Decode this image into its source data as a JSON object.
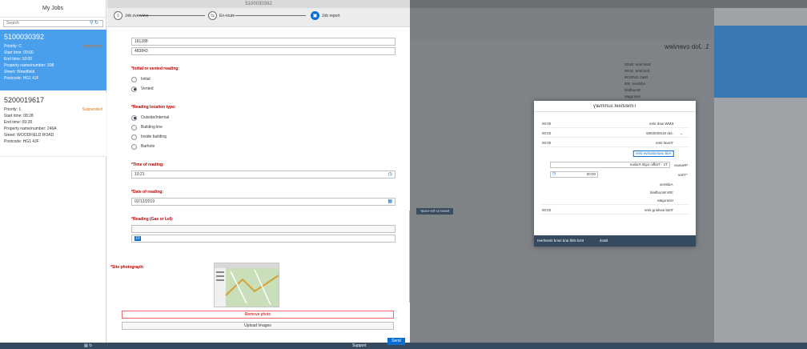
{
  "master": {
    "title": "My Jobs",
    "search_placeholder": "Search",
    "jobs": [
      {
        "id": "5100030392",
        "priority": "Priority: C",
        "status": "Suspended",
        "start": "Start time: 09:00",
        "end": "End time: 10:00",
        "property": "Property name/number: 308",
        "street": "Street: Woodfield",
        "postcode": "Postcode: HG1 4JF"
      },
      {
        "id": "5200019617",
        "priority": "Priority: 1",
        "status": "Suspended",
        "start": "Start time: 08:28",
        "end": "End time: 09:28",
        "property": "Property name/number: 246A",
        "street": "Street: WOODFIELD ROAD",
        "postcode": "Postcode: HG1 4JF"
      }
    ]
  },
  "detail": {
    "title": "5100030392",
    "steps": [
      {
        "label": "Job overview"
      },
      {
        "label": "En-route"
      },
      {
        "label": "Job report"
      }
    ],
    "values": {
      "v1": "181288",
      "v2": "483843"
    },
    "initial_label": "*Initial or vented reading:",
    "initial_options": [
      "Initial",
      "Vented"
    ],
    "location_label": "*Reading location type:",
    "location_options": [
      "Outside/Internal",
      "Building line",
      "Inside building",
      "Barhole"
    ],
    "time_label": "*Time of reading:",
    "time_value": "10:21",
    "date_label": "*Date of reading:",
    "date_value": "02/12/2019",
    "reading_label": "*Reading (Gas or Lel):",
    "reading_value": "10",
    "photo_label": "*Site photograph:",
    "remove_photo": "Remove photo",
    "upload_images": "Upload Images"
  },
  "footer": {
    "send": "Send",
    "support": "Support"
  },
  "dialog": {
    "title": "Timesheet summary",
    "rows": [
      {
        "label": "EMW web time",
        "value": "00:00"
      },
      {
        "label": "Job 5100030392",
        "value": "03:00"
      },
      {
        "label": "Travel time",
        "value": "00:00"
      }
    ],
    "add_button": "Add unproductive time",
    "reason_label": "*Reason",
    "reason_value": "T1 - Traffic Light Failure",
    "time_label": "*Time",
    "time_value": "00:00",
    "address_label": "Address",
    "address_lines": [
      "308 Woodfield",
      "Harrogate"
    ],
    "total_label": "Total working time",
    "total_value": "03:00",
    "end_shift": "End shift and send timesheet",
    "back": "Back"
  },
  "right_panel": {
    "title": "1. Job overview",
    "move_button": "Move to 'En-route'",
    "info_lines": [
      "Start time: 09:00",
      "End time: 10:00",
      "Start: 01/02/19",
      "Address: 308",
      "Woodfield",
      "Harrogate"
    ]
  }
}
